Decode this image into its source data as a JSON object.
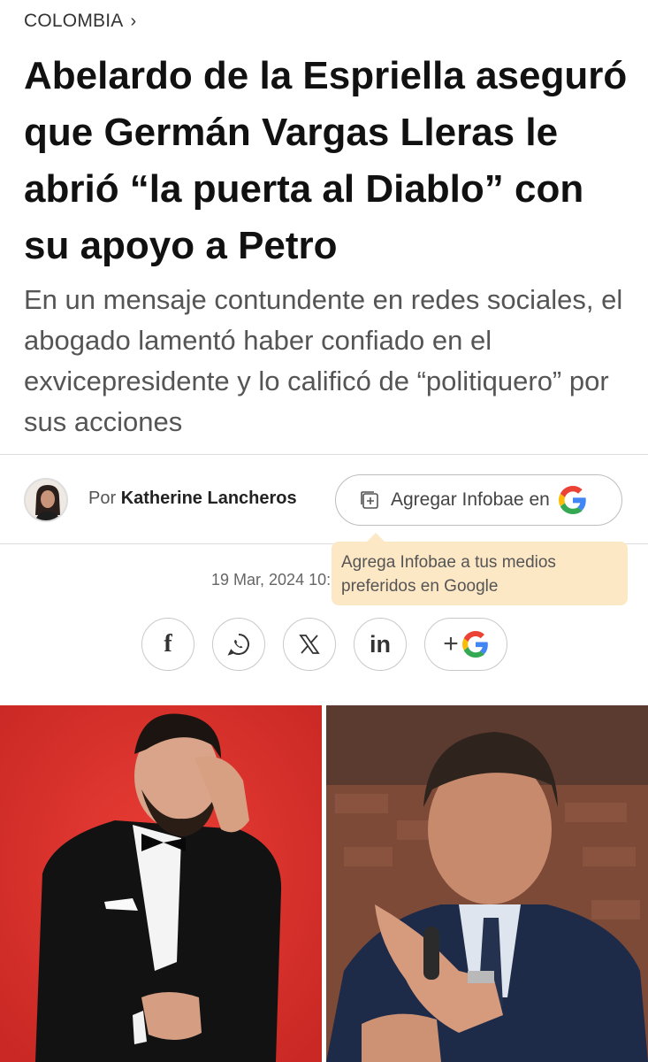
{
  "section": {
    "label": "COLOMBIA",
    "chevron": "›"
  },
  "article": {
    "headline": "Abelardo de la Espriella aseguró que Germán Vargas Lleras le abrió “la puerta al Diablo” con su apoyo a Petro",
    "subheadline": "En un mensaje contundente en redes sociales, el abogado lamentó haber confiado en el exvicepresidente y lo calificó de “politiquero” por sus acciones",
    "by_prefix": "Por",
    "author": "Katherine Lancheros",
    "date": "19 Mar, 2024 10:"
  },
  "google_button": {
    "label": "Agregar Infobae en",
    "icon": "google-logo"
  },
  "tooltip": {
    "text": "Agrega Infobae a tus medios preferidos en Google"
  },
  "share": {
    "facebook": "f",
    "linkedin": "in",
    "google_plus": "+"
  },
  "colors": {
    "red_backdrop": "#e0332f",
    "tooltip_bg": "#fde8c6",
    "google_blue": "#4285F4",
    "google_red": "#EA4335",
    "google_yellow": "#FBBC05",
    "google_green": "#34A853"
  }
}
